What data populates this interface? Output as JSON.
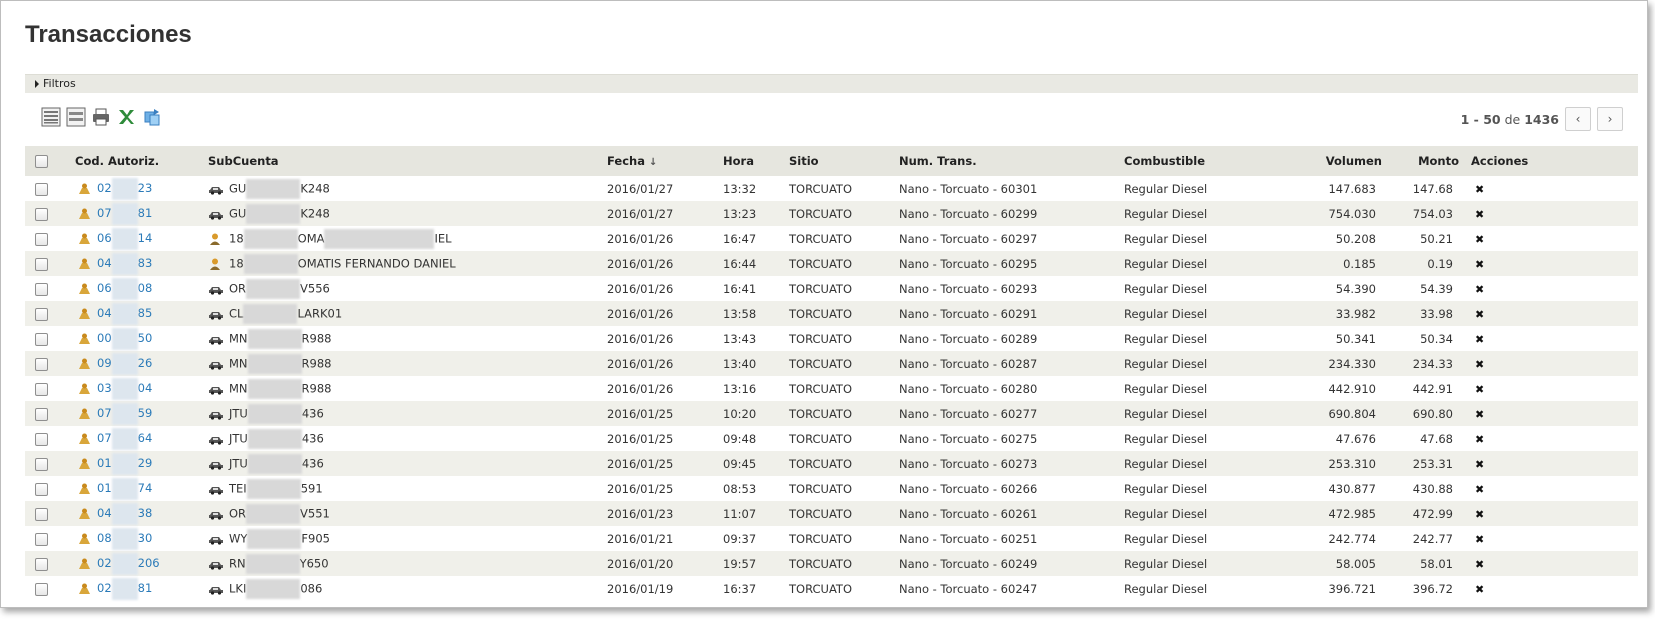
{
  "page_title": "Transacciones",
  "filters_label": "Filtros",
  "toolbar": {
    "icons": [
      "list-view-icon",
      "compact-view-icon",
      "print-icon",
      "export-excel-icon",
      "refresh-icon"
    ]
  },
  "pager": {
    "range": "1 - 50",
    "of": "de",
    "total": "1436",
    "prev": "‹",
    "next": "›"
  },
  "columns": {
    "code": "Cod. Autoriz.",
    "subcuenta": "SubCuenta",
    "fecha": "Fecha",
    "fecha_sort": "↓",
    "hora": "Hora",
    "sitio": "Sitio",
    "num": "Num. Trans.",
    "combustible": "Combustible",
    "volumen": "Volumen",
    "monto": "Monto",
    "acciones": "Acciones"
  },
  "action_glyph": "✖",
  "rows": [
    {
      "code_a": "02",
      "code_b": "23",
      "sub_type": "car",
      "sub_a": "GU",
      "sub_b": "K248",
      "fecha": "2016/01/27",
      "hora": "13:32",
      "sitio": "TORCUATO",
      "num": "Nano - Torcuato - 60301",
      "comb": "Regular Diesel",
      "vol": "147.683",
      "monto": "147.68"
    },
    {
      "code_a": "07",
      "code_b": "81",
      "sub_type": "car",
      "sub_a": "GU",
      "sub_b": "K248",
      "fecha": "2016/01/27",
      "hora": "13:23",
      "sitio": "TORCUATO",
      "num": "Nano - Torcuato - 60299",
      "comb": "Regular Diesel",
      "vol": "754.030",
      "monto": "754.03"
    },
    {
      "code_a": "06",
      "code_b": "14",
      "sub_type": "person",
      "sub_a": "18",
      "sub_b": "OMA",
      "sub_c": "IEL",
      "fecha": "2016/01/26",
      "hora": "16:47",
      "sitio": "TORCUATO",
      "num": "Nano - Torcuato - 60297",
      "comb": "Regular Diesel",
      "vol": "50.208",
      "monto": "50.21"
    },
    {
      "code_a": "04",
      "code_b": "83",
      "sub_type": "person",
      "sub_a": "18",
      "sub_b": "OMATIS FERNANDO DANIEL",
      "fecha": "2016/01/26",
      "hora": "16:44",
      "sitio": "TORCUATO",
      "num": "Nano - Torcuato - 60295",
      "comb": "Regular Diesel",
      "vol": "0.185",
      "monto": "0.19"
    },
    {
      "code_a": "06",
      "code_b": "08",
      "sub_type": "car",
      "sub_a": "OR",
      "sub_b": "V556",
      "fecha": "2016/01/26",
      "hora": "16:41",
      "sitio": "TORCUATO",
      "num": "Nano - Torcuato - 60293",
      "comb": "Regular Diesel",
      "vol": "54.390",
      "monto": "54.39"
    },
    {
      "code_a": "04",
      "code_b": "85",
      "sub_type": "car",
      "sub_a": "CL",
      "sub_b": "LARK01",
      "fecha": "2016/01/26",
      "hora": "13:58",
      "sitio": "TORCUATO",
      "num": "Nano - Torcuato - 60291",
      "comb": "Regular Diesel",
      "vol": "33.982",
      "monto": "33.98"
    },
    {
      "code_a": "00",
      "code_b": "50",
      "sub_type": "car",
      "sub_a": "MN",
      "sub_b": "R988",
      "fecha": "2016/01/26",
      "hora": "13:43",
      "sitio": "TORCUATO",
      "num": "Nano - Torcuato - 60289",
      "comb": "Regular Diesel",
      "vol": "50.341",
      "monto": "50.34"
    },
    {
      "code_a": "09",
      "code_b": "26",
      "sub_type": "car",
      "sub_a": "MN",
      "sub_b": "R988",
      "fecha": "2016/01/26",
      "hora": "13:40",
      "sitio": "TORCUATO",
      "num": "Nano - Torcuato - 60287",
      "comb": "Regular Diesel",
      "vol": "234.330",
      "monto": "234.33"
    },
    {
      "code_a": "03",
      "code_b": "04",
      "sub_type": "car",
      "sub_a": "MN",
      "sub_b": "R988",
      "fecha": "2016/01/26",
      "hora": "13:16",
      "sitio": "TORCUATO",
      "num": "Nano - Torcuato - 60280",
      "comb": "Regular Diesel",
      "vol": "442.910",
      "monto": "442.91"
    },
    {
      "code_a": "07",
      "code_b": "59",
      "sub_type": "car",
      "sub_a": "JTU",
      "sub_b": "436",
      "fecha": "2016/01/25",
      "hora": "10:20",
      "sitio": "TORCUATO",
      "num": "Nano - Torcuato - 60277",
      "comb": "Regular Diesel",
      "vol": "690.804",
      "monto": "690.80"
    },
    {
      "code_a": "07",
      "code_b": "64",
      "sub_type": "car",
      "sub_a": "JTU",
      "sub_b": "436",
      "fecha": "2016/01/25",
      "hora": "09:48",
      "sitio": "TORCUATO",
      "num": "Nano - Torcuato - 60275",
      "comb": "Regular Diesel",
      "vol": "47.676",
      "monto": "47.68"
    },
    {
      "code_a": "01",
      "code_b": "29",
      "sub_type": "car",
      "sub_a": "JTU",
      "sub_b": "436",
      "fecha": "2016/01/25",
      "hora": "09:45",
      "sitio": "TORCUATO",
      "num": "Nano - Torcuato - 60273",
      "comb": "Regular Diesel",
      "vol": "253.310",
      "monto": "253.31"
    },
    {
      "code_a": "01",
      "code_b": "74",
      "sub_type": "car",
      "sub_a": "TEI",
      "sub_b": "591",
      "fecha": "2016/01/25",
      "hora": "08:53",
      "sitio": "TORCUATO",
      "num": "Nano - Torcuato - 60266",
      "comb": "Regular Diesel",
      "vol": "430.877",
      "monto": "430.88"
    },
    {
      "code_a": "04",
      "code_b": "38",
      "sub_type": "car",
      "sub_a": "OR",
      "sub_b": "V551",
      "fecha": "2016/01/23",
      "hora": "11:07",
      "sitio": "TORCUATO",
      "num": "Nano - Torcuato - 60261",
      "comb": "Regular Diesel",
      "vol": "472.985",
      "monto": "472.99"
    },
    {
      "code_a": "08",
      "code_b": "30",
      "sub_type": "car",
      "sub_a": "WY",
      "sub_b": "F905",
      "fecha": "2016/01/21",
      "hora": "09:37",
      "sitio": "TORCUATO",
      "num": "Nano - Torcuato - 60251",
      "comb": "Regular Diesel",
      "vol": "242.774",
      "monto": "242.77"
    },
    {
      "code_a": "02",
      "code_b": "206",
      "sub_type": "car",
      "sub_a": "RN",
      "sub_b": "Y650",
      "fecha": "2016/01/20",
      "hora": "19:57",
      "sitio": "TORCUATO",
      "num": "Nano - Torcuato - 60249",
      "comb": "Regular Diesel",
      "vol": "58.005",
      "monto": "58.01"
    },
    {
      "code_a": "02",
      "code_b": "81",
      "sub_type": "car",
      "sub_a": "LKI",
      "sub_b": "086",
      "fecha": "2016/01/19",
      "hora": "16:37",
      "sitio": "TORCUATO",
      "num": "Nano - Torcuato - 60247",
      "comb": "Regular Diesel",
      "vol": "396.721",
      "monto": "396.72"
    }
  ]
}
